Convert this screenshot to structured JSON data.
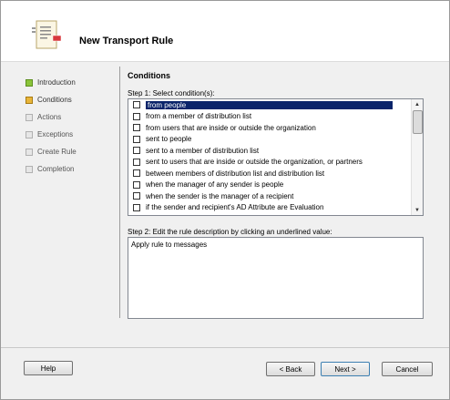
{
  "header": {
    "title": "New Transport Rule"
  },
  "nav": [
    {
      "label": "Introduction",
      "state": "done"
    },
    {
      "label": "Conditions",
      "state": "current"
    },
    {
      "label": "Actions",
      "state": "future"
    },
    {
      "label": "Exceptions",
      "state": "future"
    },
    {
      "label": "Create Rule",
      "state": "future"
    },
    {
      "label": "Completion",
      "state": "future"
    }
  ],
  "main": {
    "section_title": "Conditions",
    "step1_label": "Step 1: Select condition(s):",
    "conditions": [
      "from people",
      "from a member of distribution list",
      "from users that are inside or outside the organization",
      "sent to people",
      "sent to a member of distribution list",
      "sent to users that are inside or outside the organization, or partners",
      "between members of distribution list and distribution list",
      "when the manager of any sender is people",
      "when the sender is the manager of a recipient",
      "if the sender and recipient's AD Attribute are Evaluation"
    ],
    "selected_index": 0,
    "step2_label": "Step 2: Edit the rule description by clicking an underlined value:",
    "description_text": "Apply rule to messages"
  },
  "buttons": {
    "help": "Help",
    "back": "< Back",
    "next": "Next >",
    "cancel": "Cancel"
  },
  "colors": {
    "done": "#8bc43a",
    "current": "#e8b53a",
    "selection": "#0a246a"
  }
}
